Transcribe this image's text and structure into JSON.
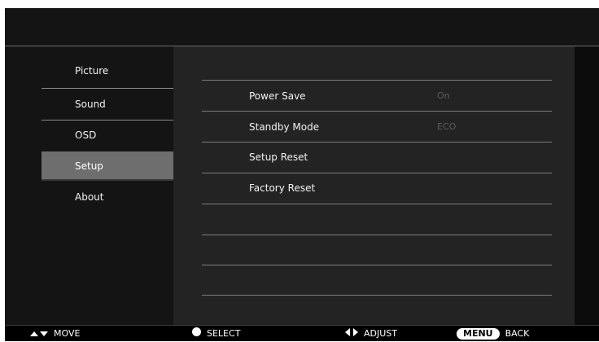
{
  "sidebar": {
    "items": [
      {
        "label": "Picture"
      },
      {
        "label": "Sound"
      },
      {
        "label": "OSD"
      },
      {
        "label": "Setup"
      },
      {
        "label": "About"
      }
    ],
    "selected_label": "Setup"
  },
  "settings": {
    "rows": [
      {
        "label": "Power Save",
        "value": "On"
      },
      {
        "label": "Standby Mode",
        "value": "ECO"
      },
      {
        "label": "Setup Reset",
        "value": ""
      },
      {
        "label": "Factory Reset",
        "value": ""
      }
    ]
  },
  "footer": {
    "move_label": "MOVE",
    "select_label": "SELECT",
    "adjust_label": "ADJUST",
    "menu_key": "MENU",
    "back_label": "BACK",
    "move_icon": "up-down-arrows-icon",
    "select_icon": "circle-dot-icon",
    "adjust_icon": "left-right-arrows-icon"
  },
  "colors": {
    "selected_item_bg": "#6e6e6e",
    "content_bg": "#232323",
    "disabled_value": "#5d5d5d"
  }
}
